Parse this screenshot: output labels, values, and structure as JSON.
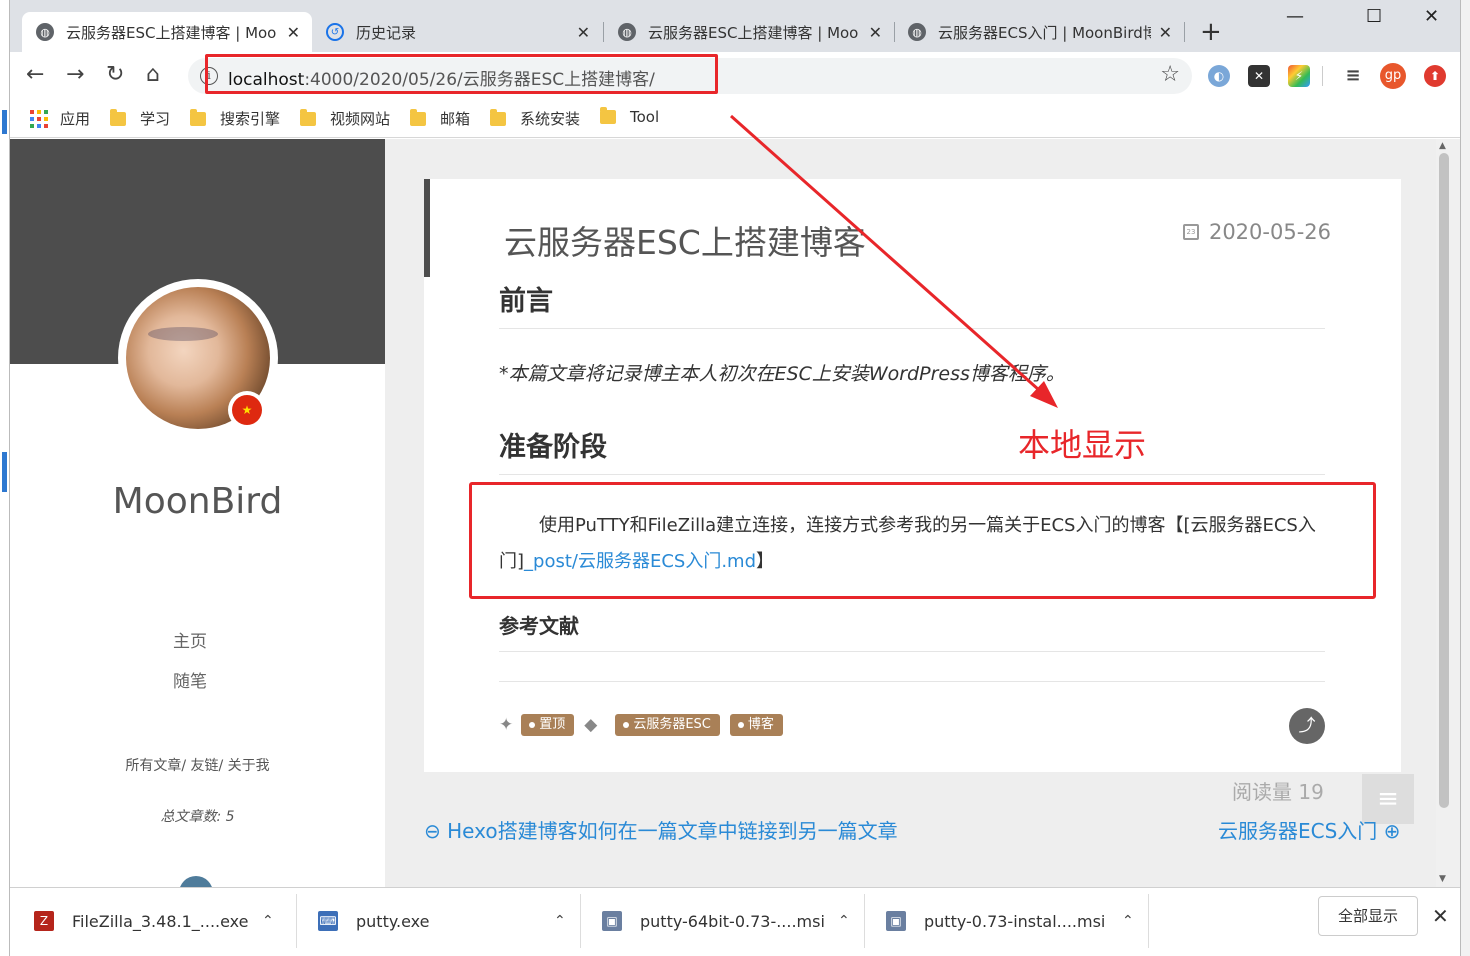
{
  "tabs": [
    {
      "title": "云服务器ESC上搭建博客 | Moo",
      "icon": "globe-icon",
      "active": true
    },
    {
      "title": "历史记录",
      "icon": "history-icon",
      "active": false
    },
    {
      "title": "云服务器ESC上搭建博客 | Moo",
      "icon": "globe-icon",
      "active": false
    },
    {
      "title": "云服务器ECS入门 | MoonBird博",
      "icon": "globe-icon",
      "active": false
    }
  ],
  "address_bar": {
    "host": "localhost",
    "path": ":4000/2020/05/26/云服务器ESC上搭建博客/"
  },
  "bookmarks": [
    {
      "label": "应用",
      "icon": "apps-grid-icon"
    },
    {
      "label": "学习",
      "icon": "folder-icon"
    },
    {
      "label": "搜索引擎",
      "icon": "folder-icon"
    },
    {
      "label": "视频网站",
      "icon": "folder-icon"
    },
    {
      "label": "邮箱",
      "icon": "folder-icon"
    },
    {
      "label": "系统安装",
      "icon": "folder-icon"
    },
    {
      "label": "Tool",
      "icon": "folder-icon"
    }
  ],
  "extensions": {
    "avatar_label": "gp"
  },
  "sidebar": {
    "site_name": "MoonBird",
    "nav": [
      "主页",
      "随笔"
    ],
    "links": "所有文章/ 友链/ 关于我",
    "count_label": "总文章数:",
    "count_value": "5"
  },
  "article": {
    "title": "云服务器ESC上搭建博客",
    "date": "2020-05-26",
    "h_intro": "前言",
    "intro_text": "*本篇文章将记录博主本人初次在ESC上安装WordPress博客程序。",
    "h_prep": "准备阶段",
    "prep_text": "使用PuTTY和FileZilla建立连接，连接方式参考我的另一篇关于ECS入门的博客【[云服务器ECS入门]",
    "prep_link": "_post/云服务器ECS入门.md",
    "prep_tail": "】",
    "h_refs": "参考文献",
    "tags": [
      "置顶",
      "云服务器ESC",
      "博客"
    ],
    "reads": "阅读量 19"
  },
  "post_nav": {
    "prev": "Hexo搭建博客如何在一篇文章中链接到另一篇文章",
    "next": "云服务器ECS入门"
  },
  "annotation": {
    "label": "本地显示",
    "color": "#e8262a"
  },
  "downloads": {
    "items": [
      "FileZilla_3.48.1_....exe",
      "putty.exe",
      "putty-64bit-0.73-....msi",
      "putty-0.73-instal....msi"
    ],
    "show_all": "全部显示"
  }
}
